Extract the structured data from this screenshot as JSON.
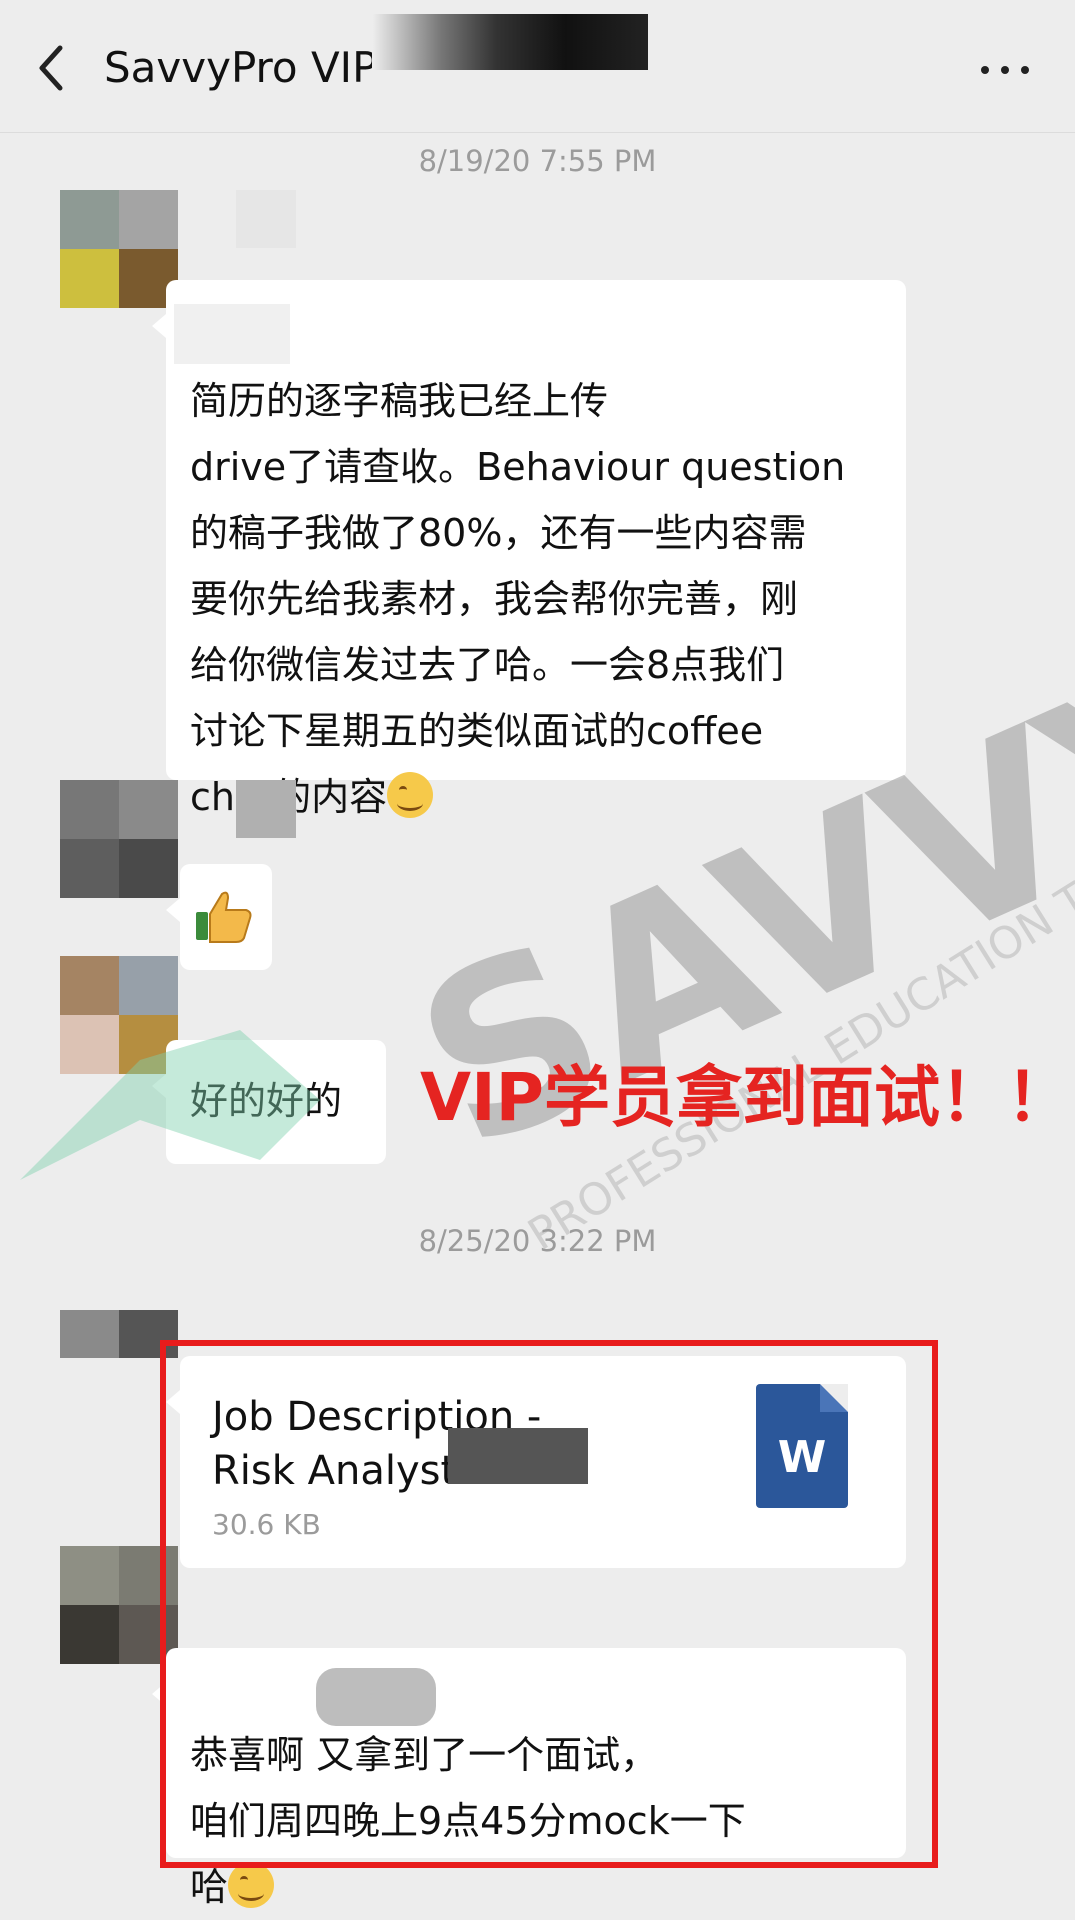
{
  "header": {
    "title": "SavvyPro VIP",
    "back_icon": "chevron-left-icon",
    "more_icon": "more-dots-icon"
  },
  "messages": {
    "time1": "8/19/20 7:55 PM",
    "msg1": "简历的逐字稿我已经上传\ndrive了请查收。Behaviour question\n的稿子我做了80%，还有一些内容需\n要你先给我素材，我会帮你完善，刚\n给你微信发过去了哈。一会8点我们\n讨论下星期五的类似面试的coffee\nchat的内容",
    "msg2_icon": "thumbs-up-icon",
    "msg3": "好的好的",
    "time2": "8/25/20 3:22 PM",
    "file": {
      "title": "Job Description -\nRisk Analyst",
      "size": "30.6 KB",
      "icon": "word-doc-icon",
      "icon_letter": "W"
    },
    "msg5": "恭喜啊         又拿到了一个面试，\n咱们周四晚上9点45分mock一下\n哈"
  },
  "overlay": {
    "promo": "VIP学员拿到面试！！",
    "watermark_main": "SAVVY PRO",
    "watermark_sub": "PROFESSIONAL EDUCATION TRAINING"
  },
  "colors": {
    "accent_red": "#e52421",
    "word_blue": "#2b579a",
    "watermark_green": "#7fd1ad"
  }
}
